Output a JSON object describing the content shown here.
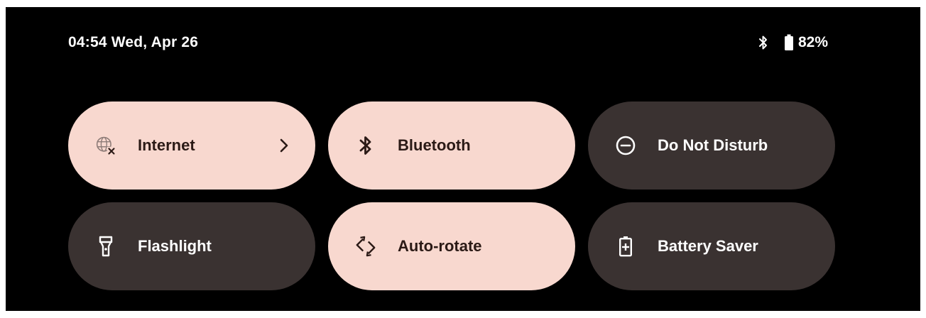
{
  "status_bar": {
    "datetime": "04:54 Wed, Apr 26",
    "battery_percent": "82%",
    "battery_level": 0.82,
    "icons": [
      "bluetooth-icon",
      "battery-icon"
    ]
  },
  "tiles": [
    {
      "label": "Internet",
      "state": "on",
      "icon": "globe-off-icon",
      "has_chevron": true
    },
    {
      "label": "Bluetooth",
      "state": "on",
      "icon": "bluetooth-icon"
    },
    {
      "label": "Do Not Disturb",
      "state": "off",
      "icon": "do-not-disturb-icon"
    },
    {
      "label": "Flashlight",
      "state": "off",
      "icon": "flashlight-icon"
    },
    {
      "label": "Auto-rotate",
      "state": "on",
      "icon": "auto-rotate-icon"
    },
    {
      "label": "Battery Saver",
      "state": "off",
      "icon": "battery-saver-icon"
    }
  ],
  "colors": {
    "background": "#000000",
    "tile_on": "#f8d8cf",
    "tile_off": "#3a3231",
    "text_on": "#2b1a16",
    "text_off": "#ffffff"
  }
}
